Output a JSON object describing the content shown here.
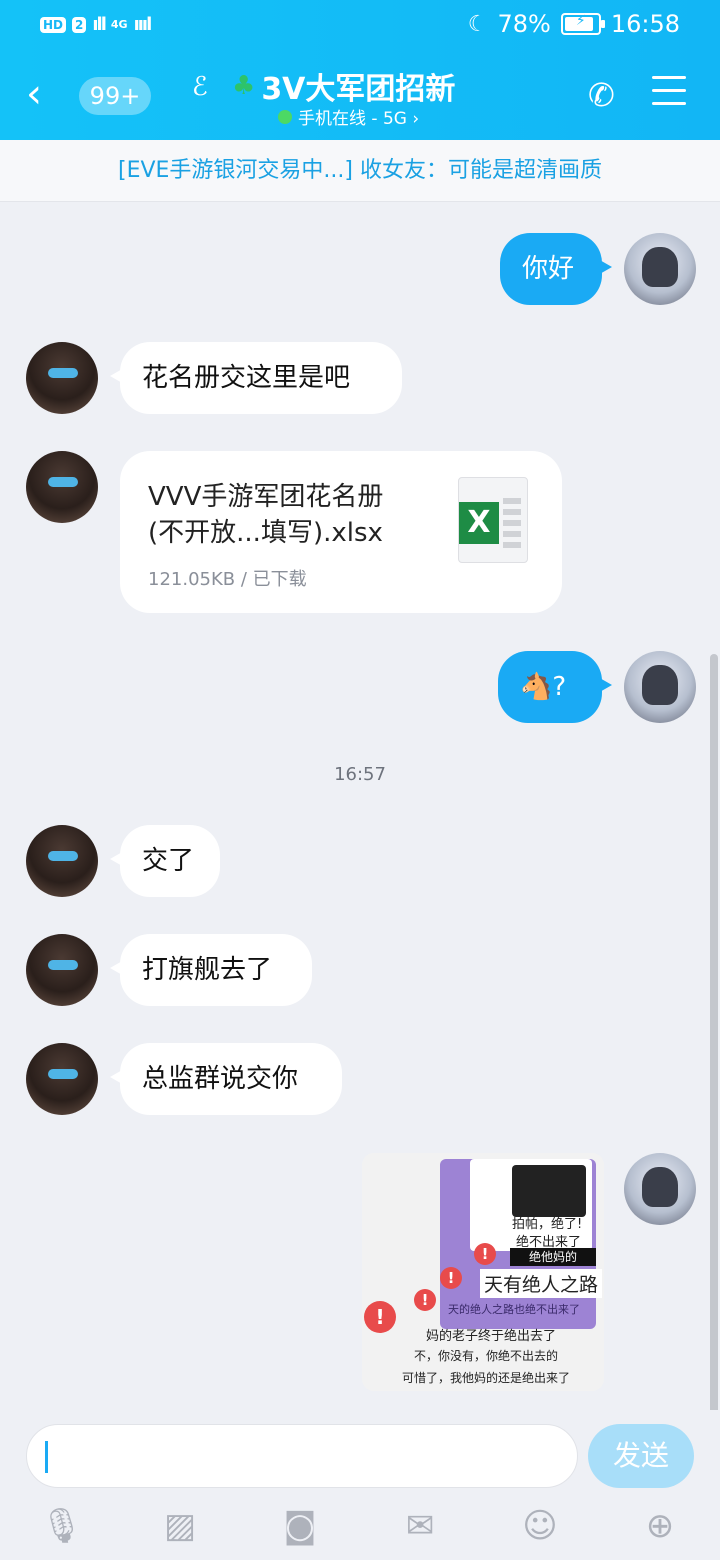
{
  "status_bar": {
    "hd": "HD",
    "sim": "2",
    "network": "4G",
    "battery": "78%",
    "time": "16:58"
  },
  "nav": {
    "back_icon": "chevron-left",
    "unread_badge": "99+",
    "title": "3V大军团招新",
    "subtitle": "手机在线 - 5G ›"
  },
  "announcement": "[EVE手游银河交易中...] 收女友：可能是超清画质",
  "messages": {
    "m1": "你好",
    "m2": "花名册交这里是吧",
    "file": {
      "name": "VVV手游军团花名册(不开放...填写).xlsx",
      "meta": "121.05KB / 已下载",
      "icon_letter": "X"
    },
    "m3": "🐴?",
    "timestamp": "16:57",
    "m4": "交了",
    "m5": "打旗舰去了",
    "m6": "总监群说交你"
  },
  "meme": {
    "cap1": "拍帕，绝了!",
    "cap2": "绝不出来了",
    "bar": "绝他妈的",
    "big": "天有绝人之路",
    "cap3": "天的绝人之路也绝不出来了",
    "cap4": "妈的老子终于绝出去了",
    "cap5": "不，你没有，你绝不出去的",
    "cap6": "可惜了，我他妈的还是绝出来了",
    "warn": "!"
  },
  "input": {
    "placeholder": "",
    "send_label": "发送"
  },
  "toolbar_icons": [
    "microphone-icon",
    "image-icon",
    "camera-icon",
    "red-packet-icon",
    "emoji-icon",
    "plus-icon"
  ]
}
